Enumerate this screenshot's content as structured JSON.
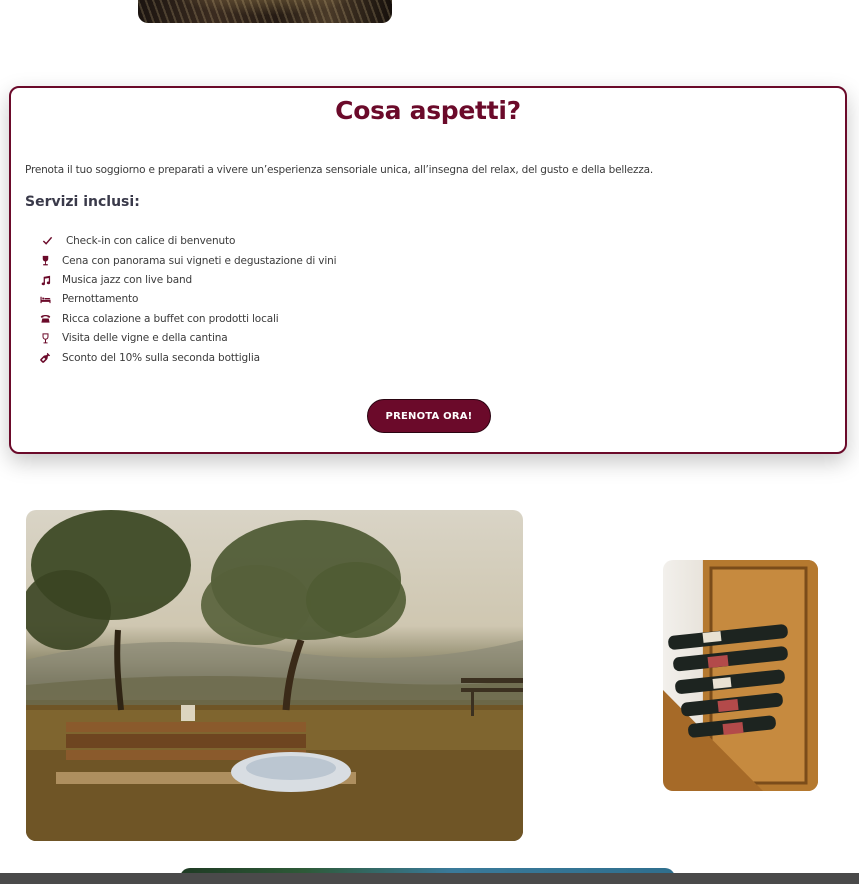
{
  "section": {
    "title": "Cosa aspetti?",
    "intro": "Prenota il tuo soggiorno e preparati a vivere un’esperienza sensoriale unica, all’insegna del relax, del gusto e della bellezza.",
    "services_title": "Servizi inclusi:",
    "services": [
      {
        "icon": "check-icon",
        "label": "Check-in con calice di benvenuto"
      },
      {
        "icon": "wine-glass-icon",
        "label": "Cena con panorama sui vigneti e degustazione di vini"
      },
      {
        "icon": "music-note-icon",
        "label": "Musica jazz con live band"
      },
      {
        "icon": "bed-icon",
        "label": "Pernottamento"
      },
      {
        "icon": "phone-icon",
        "label": "Ricca colazione a buffet con prodotti locali"
      },
      {
        "icon": "wine-glass-outline-icon",
        "label": "Visita delle vigne e della cantina"
      },
      {
        "icon": "wine-bottle-icon",
        "label": "Sconto del 10% sulla seconda bottiglia"
      }
    ],
    "cta_label": "PRENOTA ORA!"
  },
  "colors": {
    "accent": "#6b0a2a",
    "text": "#3b3b3b"
  }
}
